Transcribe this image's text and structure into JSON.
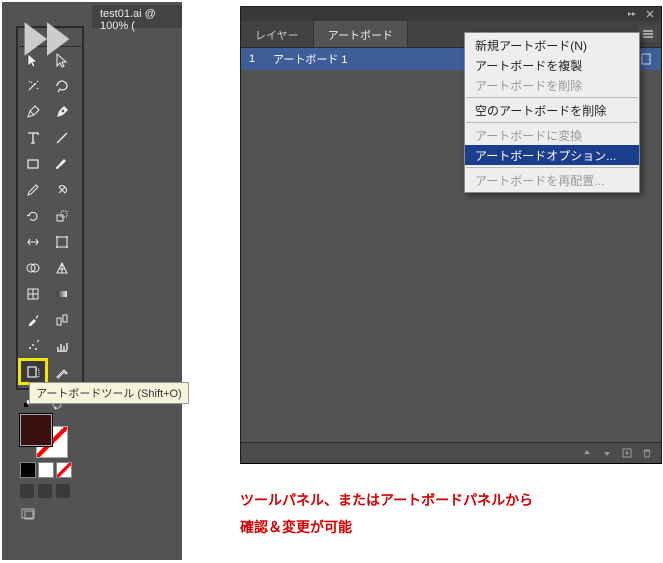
{
  "document": {
    "tab_title": "test01.ai @ 100% ("
  },
  "tools": {
    "tooltip": "アートボードツール (Shift+O)"
  },
  "panel": {
    "tabs": {
      "layers": "レイヤー",
      "artboards": "アートボード"
    },
    "rows": [
      {
        "index": "1",
        "name": "アートボード 1"
      }
    ]
  },
  "context_menu": {
    "items": [
      {
        "label": "新規アートボード(N)",
        "state": "normal"
      },
      {
        "label": "アートボードを複製",
        "state": "normal"
      },
      {
        "label": "アートボードを削除",
        "state": "disabled"
      },
      {
        "label": "空のアートボードを削除",
        "state": "normal"
      },
      {
        "label": "アートボードに変換",
        "state": "disabled"
      },
      {
        "label": "アートボードオプション...",
        "state": "highlight"
      },
      {
        "label": "アートボードを再配置...",
        "state": "disabled"
      }
    ]
  },
  "annotation": {
    "line1": "ツールパネル、またはアートボードパネルから",
    "line2": "確認＆変更が可能"
  }
}
